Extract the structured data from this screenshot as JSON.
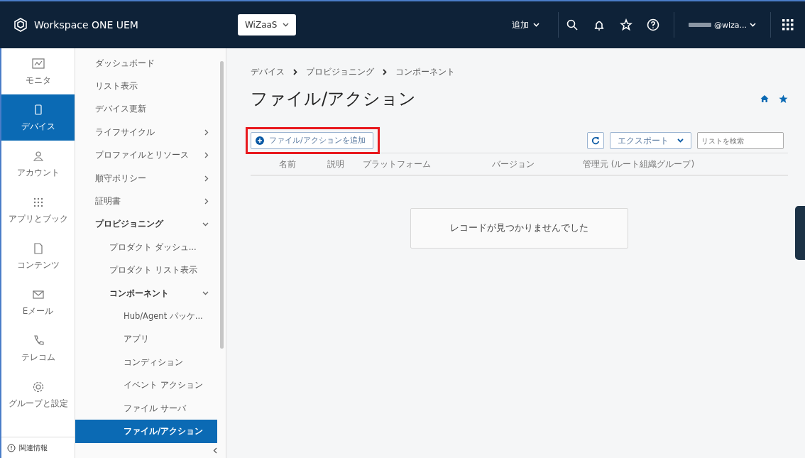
{
  "header": {
    "product": "Workspace ONE UEM",
    "org_selector": "WiZaaS",
    "add_menu": "追加",
    "account": "@wiza..."
  },
  "rail": {
    "items": [
      {
        "label": "モニタ",
        "selected": false
      },
      {
        "label": "デバイス",
        "selected": true
      },
      {
        "label": "アカウント",
        "selected": false
      },
      {
        "label": "アプリとブック",
        "selected": false
      },
      {
        "label": "コンテンツ",
        "selected": false
      },
      {
        "label": "Eメール",
        "selected": false
      },
      {
        "label": "テレコム",
        "selected": false
      },
      {
        "label": "グループと設定",
        "selected": false
      }
    ],
    "footer": "関連情報"
  },
  "nav": {
    "items": [
      {
        "label": "ダッシュボード",
        "selected": false
      },
      {
        "label": "リスト表示",
        "selected": false
      },
      {
        "label": "デバイス更新",
        "selected": false
      },
      {
        "label": "ライフサイクル",
        "expanded": false,
        "selected": false
      },
      {
        "label": "プロファイルとリソース",
        "expanded": false,
        "selected": false
      },
      {
        "label": "順守ポリシー",
        "expanded": false,
        "selected": false
      },
      {
        "label": "証明書",
        "expanded": false,
        "selected": false
      },
      {
        "label": "プロビジョニング",
        "expanded": true,
        "selected": false,
        "children": [
          {
            "label": "プロダクト ダッシュ...",
            "selected": false
          },
          {
            "label": "プロダクト リスト表示",
            "selected": false
          },
          {
            "label": "コンポーネント",
            "expanded": true,
            "selected": false,
            "children": [
              {
                "label": "Hub/Agent パッケ...",
                "selected": false
              },
              {
                "label": "アプリ",
                "selected": false
              },
              {
                "label": "コンディション",
                "selected": false
              },
              {
                "label": "イベント アクション",
                "selected": false
              },
              {
                "label": "ファイル サーバ",
                "selected": false
              },
              {
                "label": "ファイル/アクション",
                "selected": true
              }
            ]
          }
        ]
      }
    ]
  },
  "main": {
    "breadcrumb": [
      "デバイス",
      "プロビジョニング",
      "コンポーネント"
    ],
    "title": "ファイル/アクション",
    "add_button": {
      "label": "ファイル/アクションを追加",
      "highlighted": true
    },
    "export_button": "エクスポート",
    "search": {
      "placeholder": "リストを検索"
    },
    "columns": [
      "名前",
      "説明",
      "プラットフォーム",
      "バージョン",
      "管理元 (ルート組織グループ)"
    ],
    "empty_message": "レコードが見つかりませんでした"
  }
}
